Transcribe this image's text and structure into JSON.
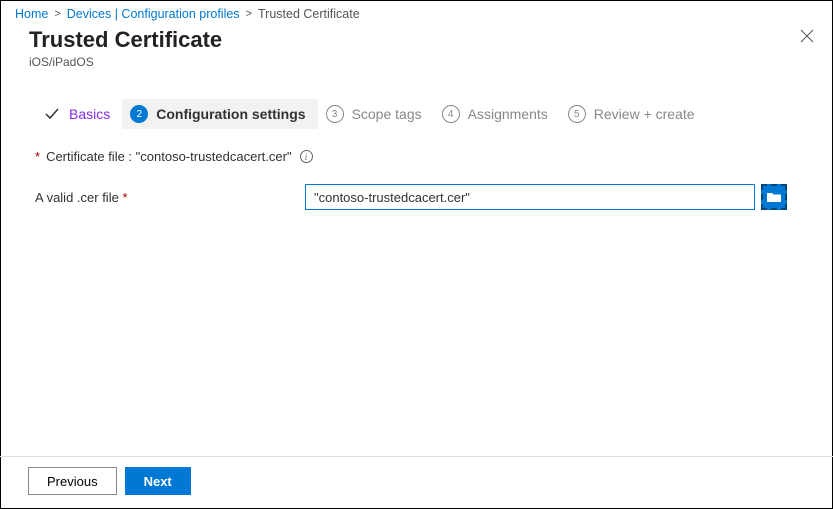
{
  "breadcrumb": {
    "home": "Home",
    "devices": "Devices | Configuration profiles",
    "current": "Trusted Certificate"
  },
  "header": {
    "title": "Trusted Certificate",
    "subtitle": "iOS/iPadOS"
  },
  "wizard": {
    "steps": [
      {
        "num": "",
        "label": "Basics"
      },
      {
        "num": "2",
        "label": "Configuration settings"
      },
      {
        "num": "3",
        "label": "Scope tags"
      },
      {
        "num": "4",
        "label": "Assignments"
      },
      {
        "num": "5",
        "label": "Review + create"
      }
    ]
  },
  "content": {
    "cert_prefix": "Certificate file : ",
    "cert_name": "\"contoso-trustedcacert.cer\"",
    "field_label": "A valid .cer file",
    "field_value": "\"contoso-trustedcacert.cer\"",
    "required_marker": "*"
  },
  "footer": {
    "previous": "Previous",
    "next": "Next"
  }
}
